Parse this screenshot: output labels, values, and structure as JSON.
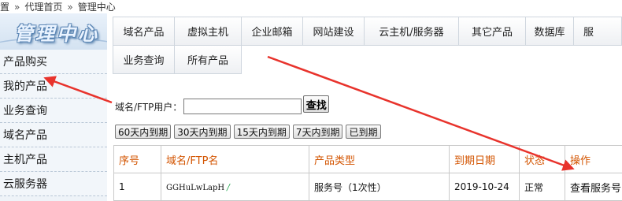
{
  "breadcrumb": {
    "items": [
      "置",
      "代理首页",
      "管理中心"
    ],
    "separator": "»"
  },
  "sidebar": {
    "logo_text": "管理中心",
    "items": [
      {
        "label": "产品购买"
      },
      {
        "label": "我的产品"
      },
      {
        "label": "业务查询"
      },
      {
        "label": "域名产品"
      },
      {
        "label": "主机产品"
      },
      {
        "label": "云服务器"
      }
    ]
  },
  "nav": {
    "row1": [
      "域名产品",
      "虚拟主机",
      "企业邮箱",
      "网站建设",
      "云主机/服务器",
      "其它产品",
      "数据库",
      "服"
    ],
    "row2": [
      "业务查询",
      "所有产品"
    ]
  },
  "search": {
    "label": "域名/FTP用户：",
    "value": "",
    "button": "查找"
  },
  "filters": [
    "60天内到期",
    "30天内到期",
    "15天内到期",
    "7天内到期",
    "已到期"
  ],
  "table": {
    "headers": [
      "序号",
      "域名/FTP名",
      "产品类型",
      "到期日期",
      "状态",
      "操作"
    ],
    "rows": [
      {
        "index": "1",
        "name": "GGHuLwLapH",
        "edit_icon": "/",
        "type": "服务号（1次性）",
        "expiry": "2019-10-24",
        "status": "正常",
        "action": "查看服务号"
      }
    ]
  },
  "annotation_color": "#e8332c"
}
